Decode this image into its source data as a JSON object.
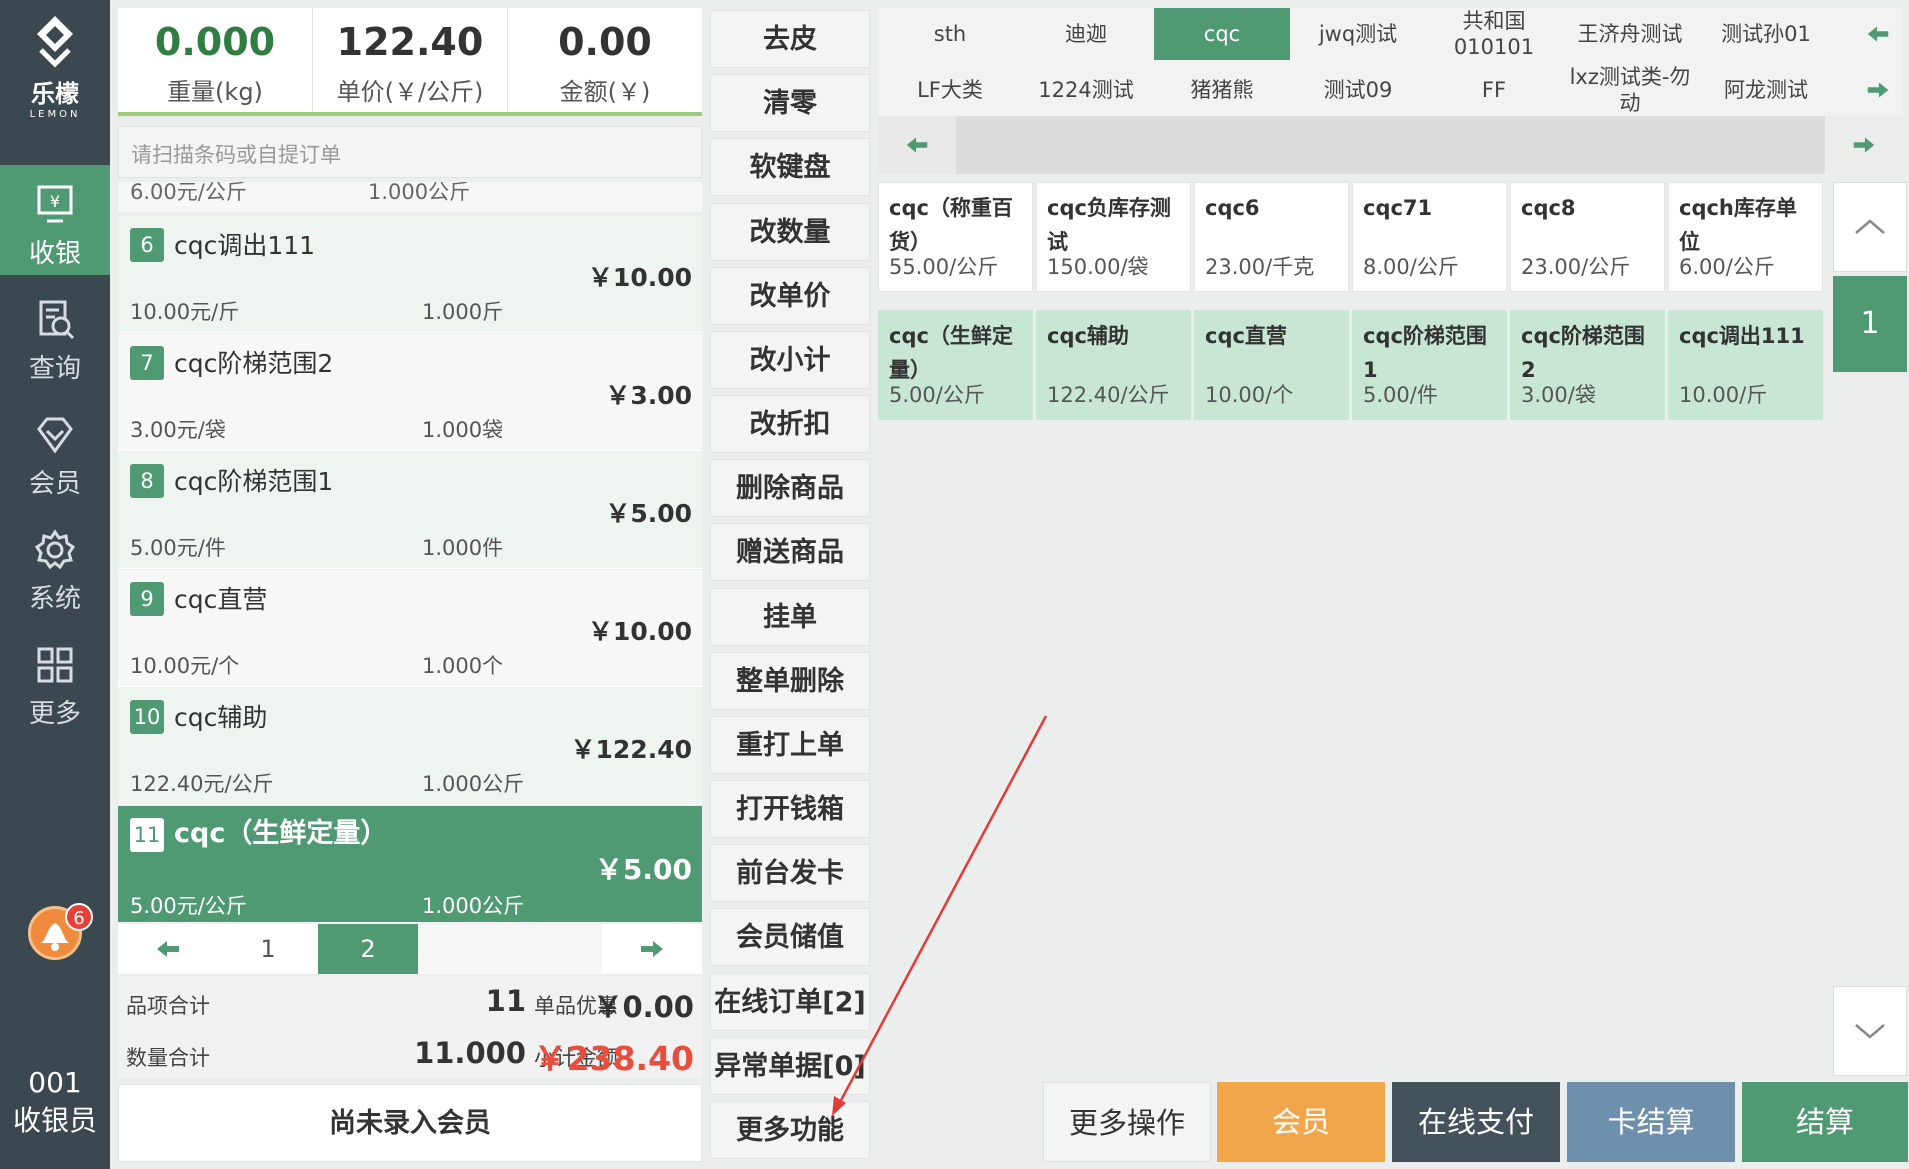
{
  "sidebar": {
    "logo_text": "乐檬",
    "logo_sub": "LEMON",
    "nav": [
      {
        "label": "收银",
        "icon": "cashier-icon",
        "active": true
      },
      {
        "label": "查询",
        "icon": "query-icon",
        "active": false
      },
      {
        "label": "会员",
        "icon": "member-diamond-icon",
        "active": false
      },
      {
        "label": "系统",
        "icon": "gear-icon",
        "active": false
      },
      {
        "label": "更多",
        "icon": "grid-icon",
        "active": false
      }
    ],
    "notification_count": "6",
    "operator_id": "001",
    "operator_role": "收银员"
  },
  "scale": {
    "weight_value": "0.000",
    "weight_label": "重量(kg)",
    "price_value": "122.40",
    "price_label": "单价(￥/公斤)",
    "amount_value": "0.00",
    "amount_label": "金额(￥)"
  },
  "scan": {
    "placeholder": "请扫描条码或自提订单"
  },
  "order": {
    "partial_row": {
      "unit_price": "6.00元/公斤",
      "qty": "1.000公斤"
    },
    "rows": [
      {
        "index": "6",
        "name": "cqc调出111",
        "amount": "￥10.00",
        "unit_price": "10.00元/斤",
        "qty": "1.000斤"
      },
      {
        "index": "7",
        "name": "cqc阶梯范围2",
        "amount": "￥3.00",
        "unit_price": "3.00元/袋",
        "qty": "1.000袋"
      },
      {
        "index": "8",
        "name": "cqc阶梯范围1",
        "amount": "￥5.00",
        "unit_price": "5.00元/件",
        "qty": "1.000件"
      },
      {
        "index": "9",
        "name": "cqc直营",
        "amount": "￥10.00",
        "unit_price": "10.00元/个",
        "qty": "1.000个"
      },
      {
        "index": "10",
        "name": "cqc辅助",
        "amount": "￥122.40",
        "unit_price": "122.40元/公斤",
        "qty": "1.000公斤"
      },
      {
        "index": "11",
        "name": "cqc（生鲜定量）",
        "amount": "￥5.00",
        "unit_price": "5.00元/公斤",
        "qty": "1.000公斤"
      }
    ],
    "selected_index": "11",
    "pages": [
      "1",
      "2"
    ],
    "current_page": "2"
  },
  "totals": {
    "item_count_label": "品项合计",
    "item_count": "11",
    "discount_label": "单品优惠",
    "discount": "￥0.00",
    "qty_label": "数量合计",
    "qty": "11.000",
    "subtotal_label": "小计金额",
    "subtotal": "￥238.40"
  },
  "member_button": "尚未录入会员",
  "functions": [
    "去皮",
    "清零",
    "软键盘",
    "改数量",
    "改单价",
    "改小计",
    "改折扣",
    "删除商品",
    "赠送商品",
    "挂单",
    "整单删除",
    "重打上单",
    "打开钱箱",
    "前台发卡",
    "会员储值",
    "在线订单[2]",
    "异常单据[0]",
    "更多功能"
  ],
  "categories": {
    "row1": [
      "sth",
      "迪迦",
      "cqc",
      "jwq测试",
      "共和国010101",
      "王济舟测试",
      "测试孙01"
    ],
    "row2": [
      "LF大类",
      "1224测试",
      "猪猪熊",
      "测试09",
      "FF",
      "lxz测试类-勿动",
      "阿龙测试"
    ],
    "active": "cqc"
  },
  "products": [
    {
      "name": "cqc（称重百货）",
      "price": "55.00/公斤",
      "highlight": false
    },
    {
      "name": "cqc负库存测试",
      "price": "150.00/袋",
      "highlight": false
    },
    {
      "name": "cqc6",
      "price": "23.00/千克",
      "highlight": false
    },
    {
      "name": "cqc71",
      "price": "8.00/公斤",
      "highlight": false
    },
    {
      "name": "cqc8",
      "price": "23.00/公斤",
      "highlight": false
    },
    {
      "name": "cqch库存单位",
      "price": "6.00/公斤",
      "highlight": false
    },
    {
      "name": "cqc（生鲜定量）",
      "price": "5.00/公斤",
      "highlight": true
    },
    {
      "name": "cqc辅助",
      "price": "122.40/公斤",
      "highlight": true
    },
    {
      "name": "cqc直营",
      "price": "10.00/个",
      "highlight": true
    },
    {
      "name": "cqc阶梯范围1",
      "price": "5.00/件",
      "highlight": true
    },
    {
      "name": "cqc阶梯范围2",
      "price": "3.00/袋",
      "highlight": true
    },
    {
      "name": "cqc调出111",
      "price": "10.00/斤",
      "highlight": true
    }
  ],
  "product_page": "1",
  "actions": [
    {
      "label": "更多操作",
      "color": "#f4f4f4"
    },
    {
      "label": "会员",
      "color": "#f2a64b"
    },
    {
      "label": "在线支付",
      "color": "#44525c"
    },
    {
      "label": "卡结算",
      "color": "#6e90ad"
    },
    {
      "label": "结算",
      "color": "#4f9a72"
    }
  ],
  "colors": {
    "brand_green": "#4f9a72",
    "sidebar": "#3c4850",
    "subtotal_red": "#e94e3c",
    "annotation_red": "#e53935"
  }
}
